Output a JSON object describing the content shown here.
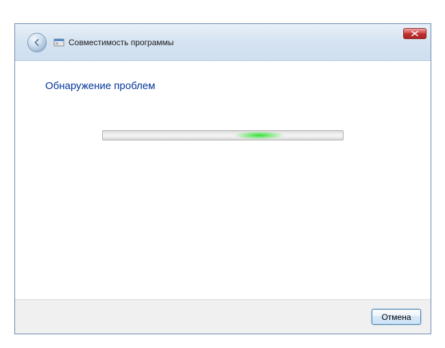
{
  "titlebar": {
    "wizard_title": "Совместимость программы"
  },
  "content": {
    "heading": "Обнаружение проблем"
  },
  "footer": {
    "cancel_label": "Отмена"
  }
}
